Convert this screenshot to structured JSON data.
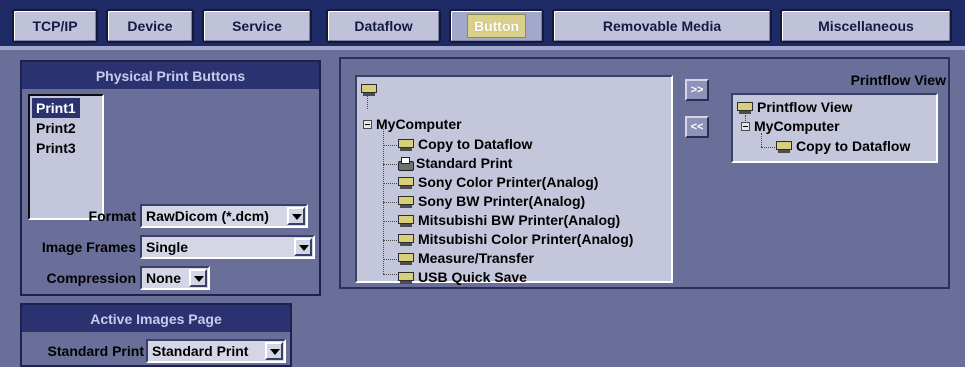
{
  "tabs": [
    {
      "label": "TCP/IP",
      "active": false
    },
    {
      "label": "Device",
      "active": false
    },
    {
      "label": "Service",
      "active": false
    },
    {
      "label": "Dataflow",
      "active": false
    },
    {
      "label": "Button",
      "active": true
    },
    {
      "label": "Removable Media",
      "active": false
    },
    {
      "label": "Miscellaneous",
      "active": false
    }
  ],
  "physical_print": {
    "title": "Physical Print Buttons",
    "buttons": [
      "Print1",
      "Print2",
      "Print3"
    ],
    "selected": "Print1",
    "format_label": "Format",
    "format_value": "RawDicom (*.dcm)",
    "image_frames_label": "Image Frames",
    "image_frames_value": "Single",
    "compression_label": "Compression",
    "compression_value": "None"
  },
  "active_images": {
    "title": "Active Images Page",
    "standard_print_label": "Standard Print",
    "standard_print_value": "Standard Print"
  },
  "available_tree": {
    "root": "MyComputer",
    "items": [
      "Copy to Dataflow",
      "Standard Print",
      "Sony Color Printer(Analog)",
      "Sony BW Printer(Analog)",
      "Mitsubishi BW Printer(Analog)",
      "Mitsubishi Color Printer(Analog)",
      "Measure/Transfer",
      "USB Quick Save"
    ]
  },
  "move_buttons": {
    "add": ">>",
    "remove": "<<"
  },
  "printflow": {
    "title": "Printflow View",
    "root": "Printflow View",
    "computer": "MyComputer",
    "item": "Copy to Dataflow"
  }
}
